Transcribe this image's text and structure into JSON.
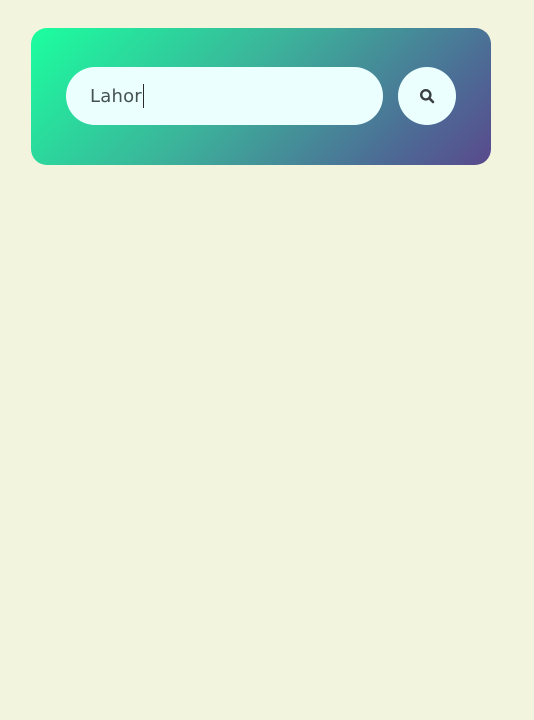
{
  "search": {
    "value": "Lahor",
    "button_icon": "search-icon",
    "gradient_colors": [
      "#1bff9f",
      "#3cb19a",
      "#4c6d96",
      "#59498d"
    ],
    "page_background": "#f3f4de",
    "field_background": "#eafffe"
  }
}
